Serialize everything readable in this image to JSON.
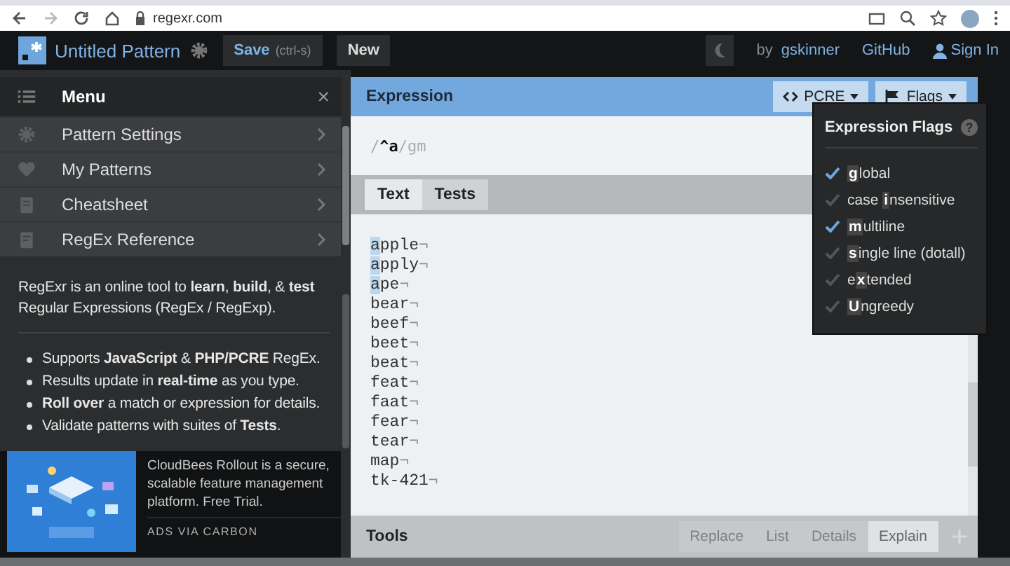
{
  "browser": {
    "url": "regexr.com"
  },
  "header": {
    "title": "Untitled Pattern",
    "save": {
      "label": "Save",
      "shortcut": "(ctrl-s)"
    },
    "new_label": "New",
    "by": "by",
    "author": "gskinner",
    "github": "GitHub",
    "sign_in": "Sign In"
  },
  "sidebar": {
    "title": "Menu",
    "close": "×",
    "items": [
      {
        "kind": "gear",
        "label": "Pattern Settings"
      },
      {
        "kind": "heart",
        "label": "My Patterns"
      },
      {
        "kind": "sheet",
        "label": "Cheatsheet"
      },
      {
        "kind": "book",
        "label": "RegEx Reference"
      }
    ],
    "intro": "RegExr is an online tool to **learn**, **build**, & **test** Regular Expressions (RegEx / RegExp).",
    "features": [
      "Supports **JavaScript** & **PHP/PCRE** RegEx.",
      "Results update in **real-time** as you type.",
      "**Roll over** a match or expression for details.",
      "Validate patterns with suites of **Tests**."
    ],
    "ad": {
      "kind": "picture",
      "text": "CloudBees Rollout is a secure, scalable feature management platform. Free Trial.",
      "via": "ADS VIA CARBON"
    }
  },
  "expression": {
    "title": "Expression",
    "engine": "PCRE",
    "flags_label": "Flags",
    "open": "/",
    "pattern": "^a",
    "close": "/",
    "flags": "gm"
  },
  "flags_menu": {
    "title": "Expression Flags",
    "help": "?",
    "items": [
      {
        "key": "g",
        "after": "lobal",
        "checked": true
      },
      {
        "before": "case ",
        "key": "i",
        "after": "nsensitive",
        "checked": false
      },
      {
        "key": "m",
        "after": "ultiline",
        "checked": true
      },
      {
        "key": "s",
        "after": "ingle line (dotall)",
        "checked": false
      },
      {
        "before": "e",
        "key": "x",
        "after": "tended",
        "checked": false
      },
      {
        "key": "U",
        "after": "ngreedy",
        "checked": false
      }
    ]
  },
  "tabs": [
    {
      "label": "Text",
      "selected": true
    },
    {
      "label": "Tests",
      "selected": false
    }
  ],
  "text_lines": [
    {
      "text": "apple",
      "match": true,
      "end": "¬"
    },
    {
      "text": "apply",
      "match": true,
      "end": "¬"
    },
    {
      "text": "ape",
      "match": true,
      "end": "¬"
    },
    {
      "text": "bear",
      "match": false,
      "end": "¬"
    },
    {
      "text": "beef",
      "match": false,
      "end": "¬"
    },
    {
      "text": "beet",
      "match": false,
      "end": "¬"
    },
    {
      "text": "beat",
      "match": false,
      "end": "¬"
    },
    {
      "text": "feat",
      "match": false,
      "end": "¬"
    },
    {
      "text": "faat",
      "match": false,
      "end": "¬"
    },
    {
      "text": "fear",
      "match": false,
      "end": "¬"
    },
    {
      "text": "tear",
      "match": false,
      "end": "¬"
    },
    {
      "text": "map",
      "match": false,
      "end": "¬"
    },
    {
      "text": "tk-421",
      "match": false,
      "end": "¬"
    }
  ],
  "tools": {
    "title": "Tools",
    "tabs": [
      {
        "label": "Replace",
        "selected": false
      },
      {
        "label": "List",
        "selected": false
      },
      {
        "label": "Details",
        "selected": false
      },
      {
        "label": "Explain",
        "selected": true
      }
    ]
  }
}
